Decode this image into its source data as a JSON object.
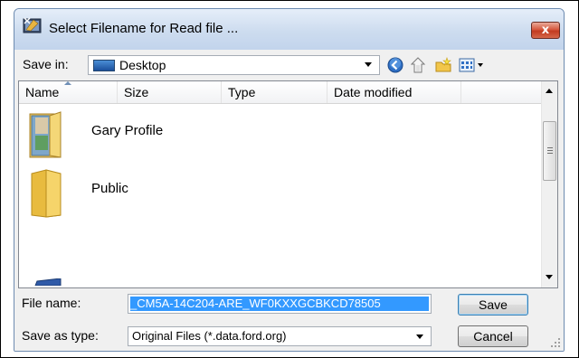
{
  "window": {
    "title": "Select Filename for Read file ...",
    "close_glyph": "x"
  },
  "toolbar": {
    "save_in_label": "Save in:",
    "save_in_value": "Desktop",
    "buttons": [
      "back-icon",
      "up-folder-icon",
      "new-folder-icon",
      "view-menu-icon"
    ]
  },
  "file_list": {
    "columns": [
      "Name",
      "Size",
      "Type",
      "Date modified"
    ],
    "sorted_by": "Name",
    "items": [
      {
        "name": "Gary Profile",
        "icon": "user-folder-icon"
      },
      {
        "name": "Public",
        "icon": "folder-icon"
      },
      {
        "name": "",
        "icon": "computer-icon"
      }
    ]
  },
  "form": {
    "file_name_label": "File name:",
    "file_name_value": "_CM5A-14C204-ARE_WF0KXXGCBKCD78505",
    "save_as_type_label": "Save as type:",
    "save_as_type_value": "Original Files (*.data.ford.org)"
  },
  "buttons": {
    "save": "Save",
    "cancel": "Cancel"
  },
  "colors": {
    "selection": "#3399ff",
    "close_button": "#c94a2f",
    "folder": "#f2c64a"
  }
}
